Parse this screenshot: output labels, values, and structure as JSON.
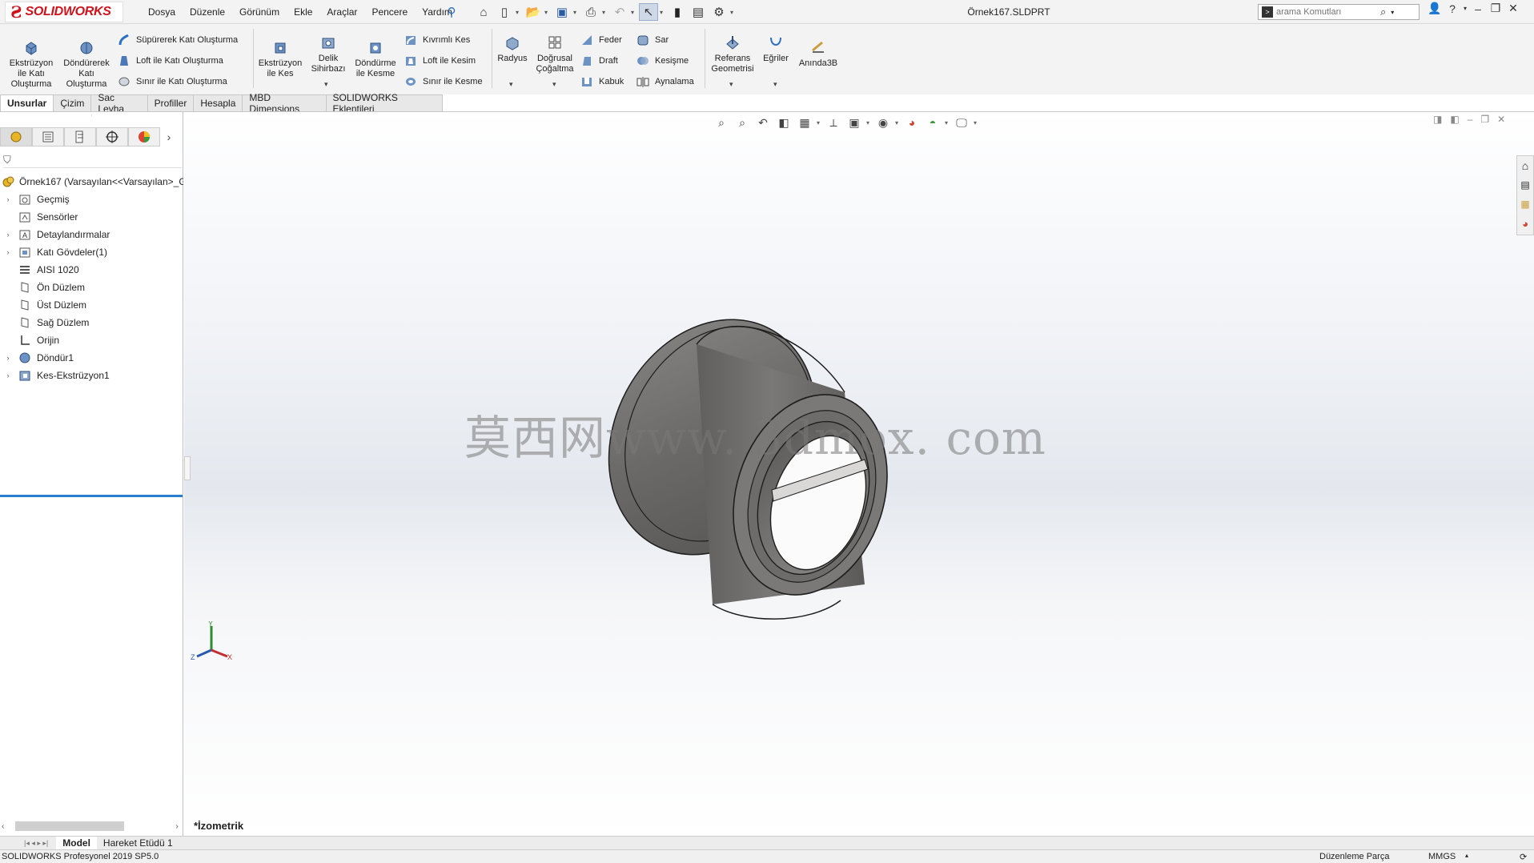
{
  "app": {
    "brand_ds": "3S",
    "brand_name": "SOLIDWORKS"
  },
  "menu": [
    "Dosya",
    "Düzenle",
    "Görünüm",
    "Ekle",
    "Araçlar",
    "Pencere",
    "Yardım"
  ],
  "document_title": "Örnek167.SLDPRT",
  "search": {
    "placeholder": "arama Komutları"
  },
  "ribbon": {
    "extrude_boss": "Ekstrüzyon ile Katı Oluşturma",
    "revolve_boss": "Döndürerek Katı Oluşturma",
    "sweep_boss": "Süpürerek Katı Oluşturma",
    "loft_boss": "Loft ile Katı Oluşturma",
    "boundary_boss": "Sınır ile Katı Oluşturma",
    "extrude_cut": "Ekstrüzyon ile Kes",
    "hole_wizard": "Delik Sihirbazı",
    "revolve_cut": "Döndürme ile Kesme",
    "swept_cut": "Kıvrımlı Kes",
    "loft_cut": "Loft ile Kesim",
    "boundary_cut": "Sınır ile Kesme",
    "fillet": "Radyus",
    "linear_pattern": "Doğrusal Çoğaltma",
    "rib": "Feder",
    "draft": "Draft",
    "shell": "Kabuk",
    "wrap": "Sar",
    "intersect": "Kesişme",
    "mirror": "Aynalama",
    "ref_geometry": "Referans Geometrisi",
    "curves": "Eğriler",
    "instant3d": "Anında3B"
  },
  "tabs": [
    "Unsurlar",
    "Çizim",
    "Sac Levha",
    "Profiller",
    "Hesapla",
    "MBD Dimensions",
    "SOLIDWORKS Eklentileri"
  ],
  "tree": {
    "root": "Örnek167  (Varsayılan<<Varsayılan>_G",
    "items": [
      "Geçmiş",
      "Sensörler",
      "Detaylandırmalar",
      "Katı Gövdeler(1)",
      "AISI 1020",
      "Ön Düzlem",
      "Üst Düzlem",
      "Sağ Düzlem",
      "Orijin",
      "Döndür1",
      "Kes-Ekstrüzyon1"
    ]
  },
  "viewport": {
    "watermark": "莫西网www. 3dmox. com",
    "view_name": "*İzometrik",
    "triad": {
      "x": "X",
      "y": "Y",
      "z": "Z"
    }
  },
  "bottom_tabs": [
    "Model",
    "Hareket Etüdü 1"
  ],
  "status": {
    "left": "SOLIDWORKS Profesyonel 2019 SP5.0",
    "mode": "Düzenleme Parça",
    "units": "MMGS"
  },
  "colors": {
    "brand_red": "#d0121b",
    "rollback_blue": "#2a7ed0",
    "part_gray": "#6e6c6a"
  }
}
